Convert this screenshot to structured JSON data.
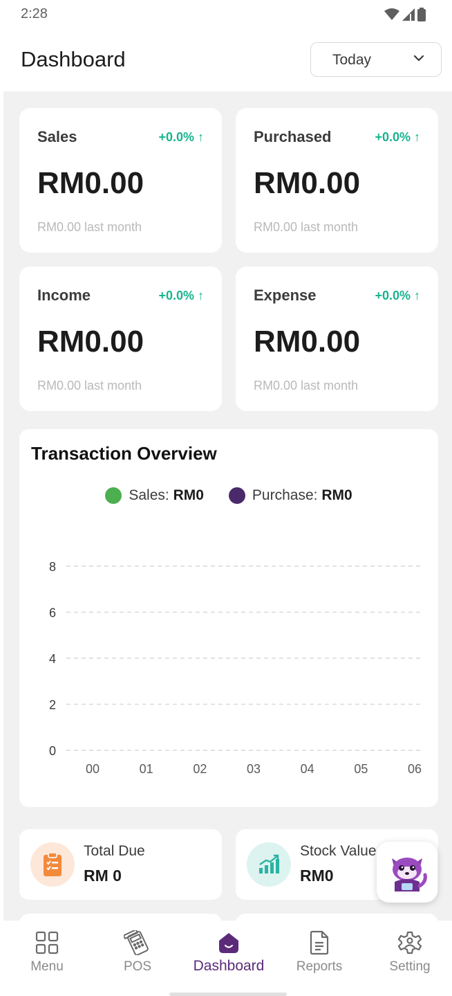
{
  "status_bar": {
    "time": "2:28"
  },
  "header": {
    "title": "Dashboard",
    "date_filter": "Today"
  },
  "stats": [
    {
      "label": "Sales",
      "change": "+0.0% ↑",
      "value": "RM0.00",
      "sub": "RM0.00 last month"
    },
    {
      "label": "Purchased",
      "change": "+0.0% ↑",
      "value": "RM0.00",
      "sub": "RM0.00 last month"
    },
    {
      "label": "Income",
      "change": "+0.0% ↑",
      "value": "RM0.00",
      "sub": "RM0.00 last month"
    },
    {
      "label": "Expense",
      "change": "+0.0% ↑",
      "value": "RM0.00",
      "sub": "RM0.00 last month"
    }
  ],
  "chart": {
    "title": "Transaction Overview",
    "legend": [
      {
        "label": "Sales:",
        "value": "RM0",
        "color": "#4caf50"
      },
      {
        "label": "Purchase:",
        "value": "RM0",
        "color": "#4b2a6b"
      }
    ]
  },
  "chart_data": {
    "type": "line",
    "title": "Transaction Overview",
    "x": [
      "00",
      "01",
      "02",
      "03",
      "04",
      "05",
      "06"
    ],
    "yticks": [
      "0",
      "2",
      "4",
      "6",
      "8"
    ],
    "ylim": [
      0,
      8
    ],
    "grid": true,
    "legend_position": "top",
    "series": [
      {
        "name": "Sales",
        "values": [
          0,
          0,
          0,
          0,
          0,
          0,
          0
        ],
        "color": "#4caf50"
      },
      {
        "name": "Purchase",
        "values": [
          0,
          0,
          0,
          0,
          0,
          0,
          0
        ],
        "color": "#4b2a6b"
      }
    ]
  },
  "summary": [
    {
      "label": "Total Due",
      "value": "RM 0",
      "icon": "clipboard-icon",
      "icon_color": "#f28a3c",
      "icon_bg": "#fde7d8"
    },
    {
      "label": "Stock Value",
      "value": "RM0",
      "icon": "growth-chart-icon",
      "icon_color": "#2bb3a3",
      "icon_bg": "#dcf3f0"
    }
  ],
  "assistant": {
    "icon": "red-panda-assistant-icon"
  },
  "nav": [
    {
      "label": "Menu",
      "icon": "grid-icon",
      "active": false
    },
    {
      "label": "POS",
      "icon": "card-terminal-icon",
      "active": false
    },
    {
      "label": "Dashboard",
      "icon": "dashboard-smile-icon",
      "active": true
    },
    {
      "label": "Reports",
      "icon": "document-icon",
      "active": false
    },
    {
      "label": "Setting",
      "icon": "settings-gear-icon",
      "active": false
    }
  ],
  "colors": {
    "accent": "#5b2a79",
    "positive": "#18b38f",
    "background": "#f2f1f2"
  }
}
